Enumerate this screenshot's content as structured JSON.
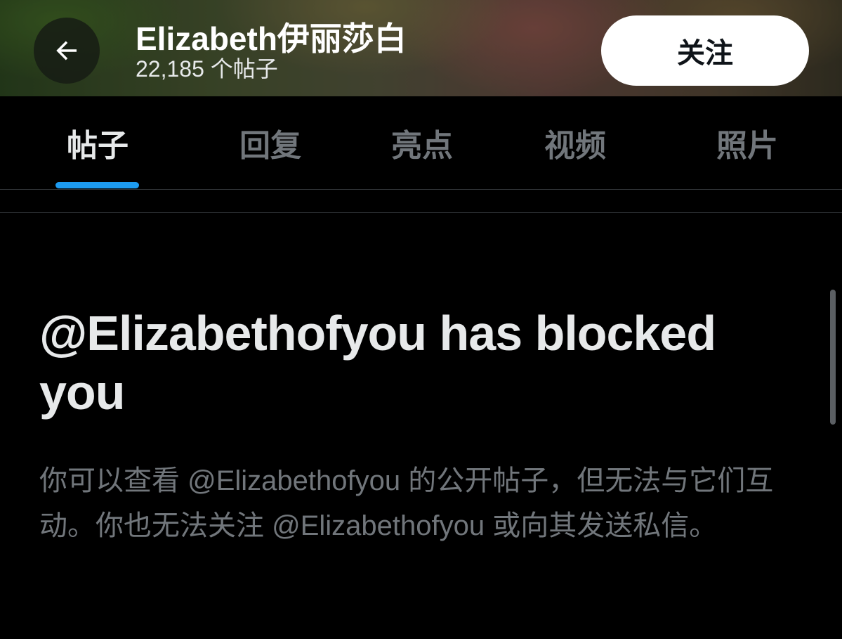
{
  "header": {
    "display_name": "Elizabeth伊丽莎白",
    "post_count": "22,185 个帖子",
    "follow_label": "关注",
    "back_icon": "arrow-left-icon"
  },
  "tabs": [
    {
      "label": "帖子",
      "active": true
    },
    {
      "label": "回复",
      "active": false
    },
    {
      "label": "亮点",
      "active": false
    },
    {
      "label": "视频",
      "active": false
    },
    {
      "label": "照片",
      "active": false
    }
  ],
  "blocked": {
    "title": "@Elizabethofyou has blocked you",
    "description": "你可以查看 @Elizabethofyou 的公开帖子，但无法与它们互动。你也无法关注 @Elizabethofyou 或向其发送私信。"
  },
  "colors": {
    "background": "#000000",
    "primary_text": "#e7e9ea",
    "secondary_text": "#71767b",
    "accent": "#1d9bf0",
    "follow_button_bg": "#ffffff"
  }
}
